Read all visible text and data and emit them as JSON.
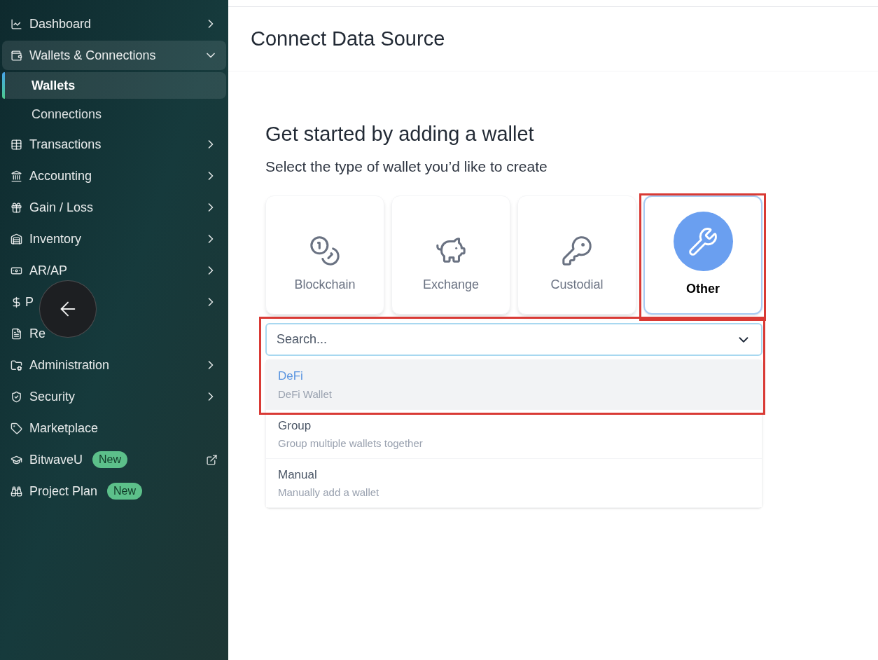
{
  "sidebar": {
    "items": [
      {
        "label": "Dashboard",
        "expanded": false,
        "selected": false
      },
      {
        "label": "Wallets & Connections",
        "expanded": true,
        "selected": true,
        "children": [
          {
            "label": "Wallets",
            "selected": true
          },
          {
            "label": "Connections",
            "selected": false
          }
        ]
      },
      {
        "label": "Transactions",
        "expanded": false,
        "selected": false
      },
      {
        "label": "Accounting",
        "expanded": false,
        "selected": false
      },
      {
        "label": "Gain / Loss",
        "expanded": false,
        "selected": false
      },
      {
        "label": "Inventory",
        "expanded": false,
        "selected": false
      },
      {
        "label": "AR/AP",
        "expanded": false,
        "selected": false
      },
      {
        "label": "P",
        "expanded": false,
        "selected": false
      },
      {
        "label": "Re",
        "selected": false
      },
      {
        "label": "Administration",
        "expanded": false,
        "selected": false
      },
      {
        "label": "Security",
        "expanded": false,
        "selected": false
      },
      {
        "label": "Marketplace",
        "selected": false
      },
      {
        "label": "BitwaveU",
        "badge": "New",
        "external": true,
        "selected": false
      },
      {
        "label": "Project Plan",
        "badge": "New",
        "selected": false
      }
    ]
  },
  "header": {
    "title": "Connect Data Source"
  },
  "content": {
    "heading": "Get started by adding a wallet",
    "subheading": "Select the type of wallet you’d like to create",
    "wallet_types": [
      {
        "label": "Blockchain",
        "selected": false,
        "annotated": false
      },
      {
        "label": "Exchange",
        "selected": false,
        "annotated": false
      },
      {
        "label": "Custodial",
        "selected": false,
        "annotated": false
      },
      {
        "label": "Other",
        "selected": true,
        "annotated": true
      }
    ],
    "search": {
      "placeholder": "Search...",
      "annotated": true
    },
    "options": [
      {
        "title": "DeFi",
        "description": "DeFi Wallet",
        "selected": true
      },
      {
        "title": "Group",
        "description": "Group multiple wallets together",
        "selected": false
      },
      {
        "title": "Manual",
        "description": "Manually add a wallet",
        "selected": false
      }
    ]
  }
}
